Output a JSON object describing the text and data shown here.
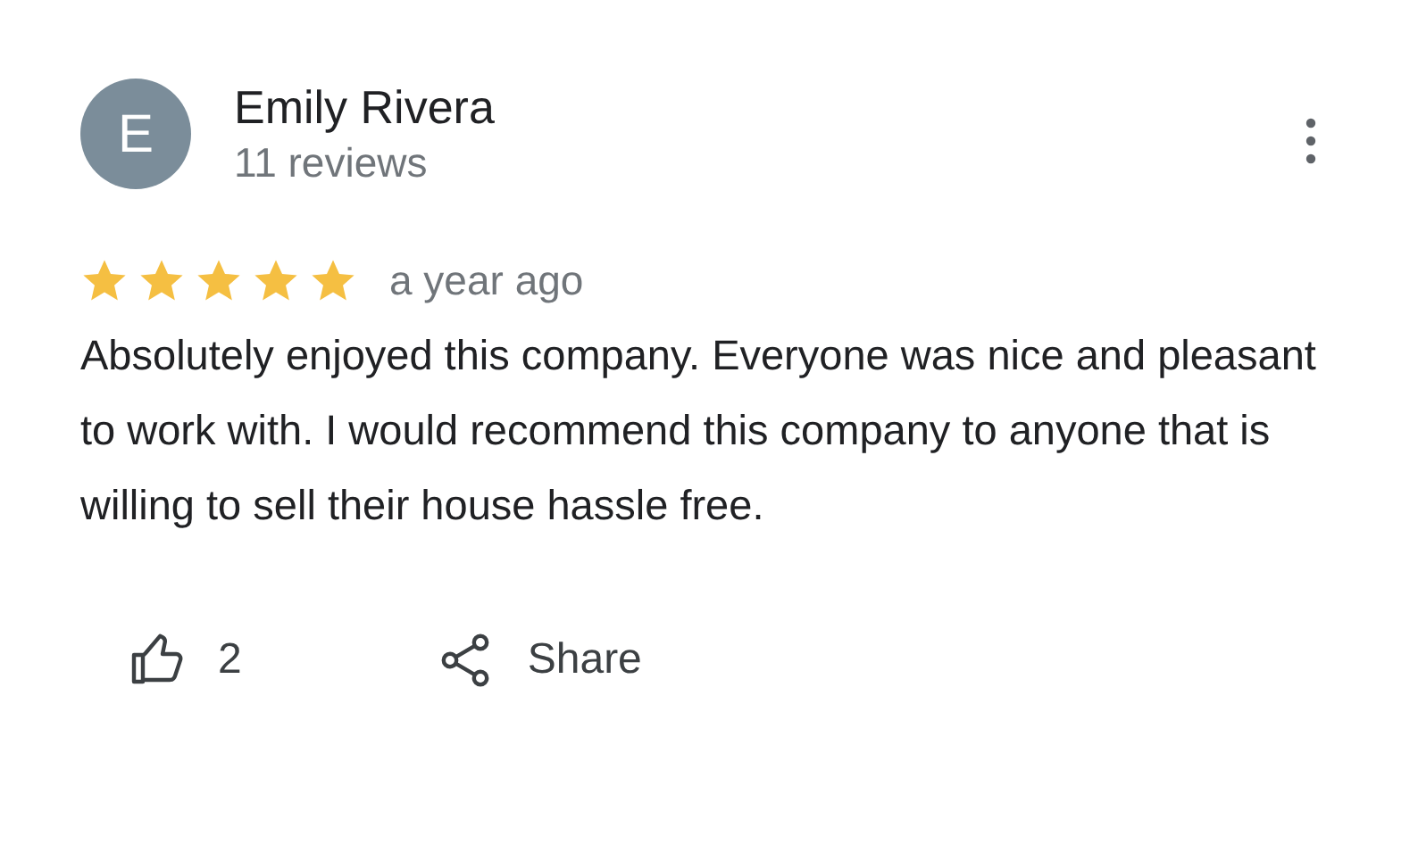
{
  "review": {
    "author": {
      "initial": "E",
      "name": "Emily Rivera",
      "subtitle": "11 reviews"
    },
    "stars": 5,
    "time": "a year ago",
    "text": "Absolutely enjoyed this company. Everyone was nice and pleasant to work with. I would recommend this company to anyone that is willing to sell their house hassle free.",
    "actions": [
      {
        "kind": "like",
        "label": "2"
      },
      {
        "kind": "share",
        "label": "Share"
      }
    ]
  }
}
